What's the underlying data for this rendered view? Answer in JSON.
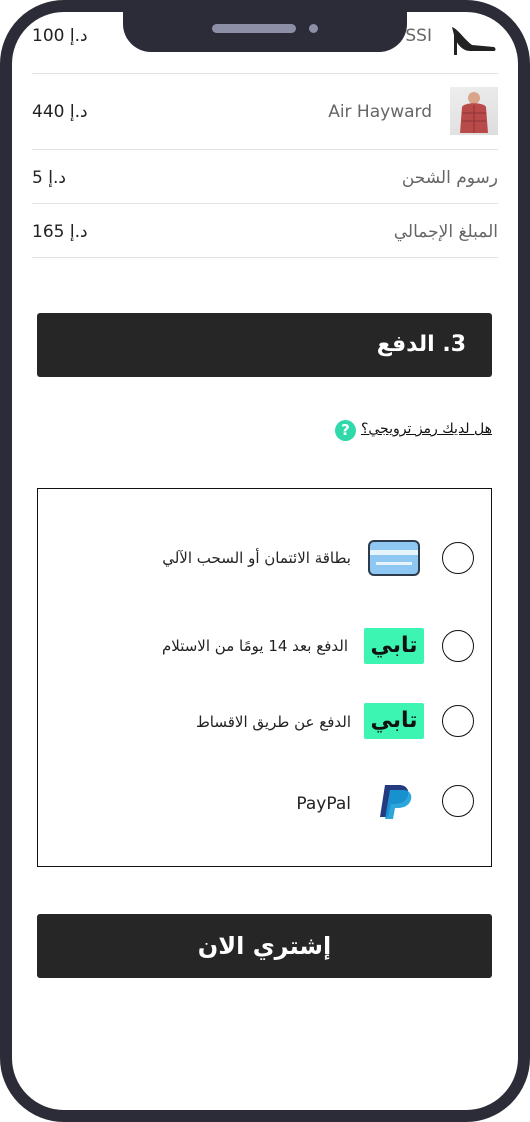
{
  "order_summary": {
    "items": [
      {
        "name": "SSI",
        "price": "100 د.إ",
        "icon": "high-heel-shoe-icon"
      },
      {
        "name": "Air Hayward",
        "price": "440 د.إ",
        "icon": "jacket-thumbnail"
      }
    ],
    "shipping": {
      "label": "رسوم الشحن",
      "value": "5 د.إ"
    },
    "total": {
      "label": "المبلغ الإجمالي",
      "value": "165 د.إ"
    }
  },
  "payment": {
    "section_title": "3. الدفع",
    "promo_link": "هل لديك رمز ترويجي؟",
    "promo_help": "?",
    "methods": [
      {
        "label": "بطاقة الائتمان أو السحب الآلي",
        "icon": "credit-card-icon",
        "selected": false
      },
      {
        "label": "الدفع بعد 14 يومًا من الاستلام",
        "icon": "tabby-logo",
        "logo_text": "تابي",
        "selected": false
      },
      {
        "label": "الدفع عن طريق الاقساط",
        "icon": "tabby-logo",
        "logo_text": "تابي",
        "selected": false
      },
      {
        "label": "PayPal",
        "icon": "paypal-icon",
        "selected": false
      }
    ]
  },
  "buy_button": "إشتري الان",
  "colors": {
    "dark": "#262626",
    "frame": "#2b2c37",
    "tabby": "#3cf5b3",
    "help": "#2fd9a9"
  }
}
